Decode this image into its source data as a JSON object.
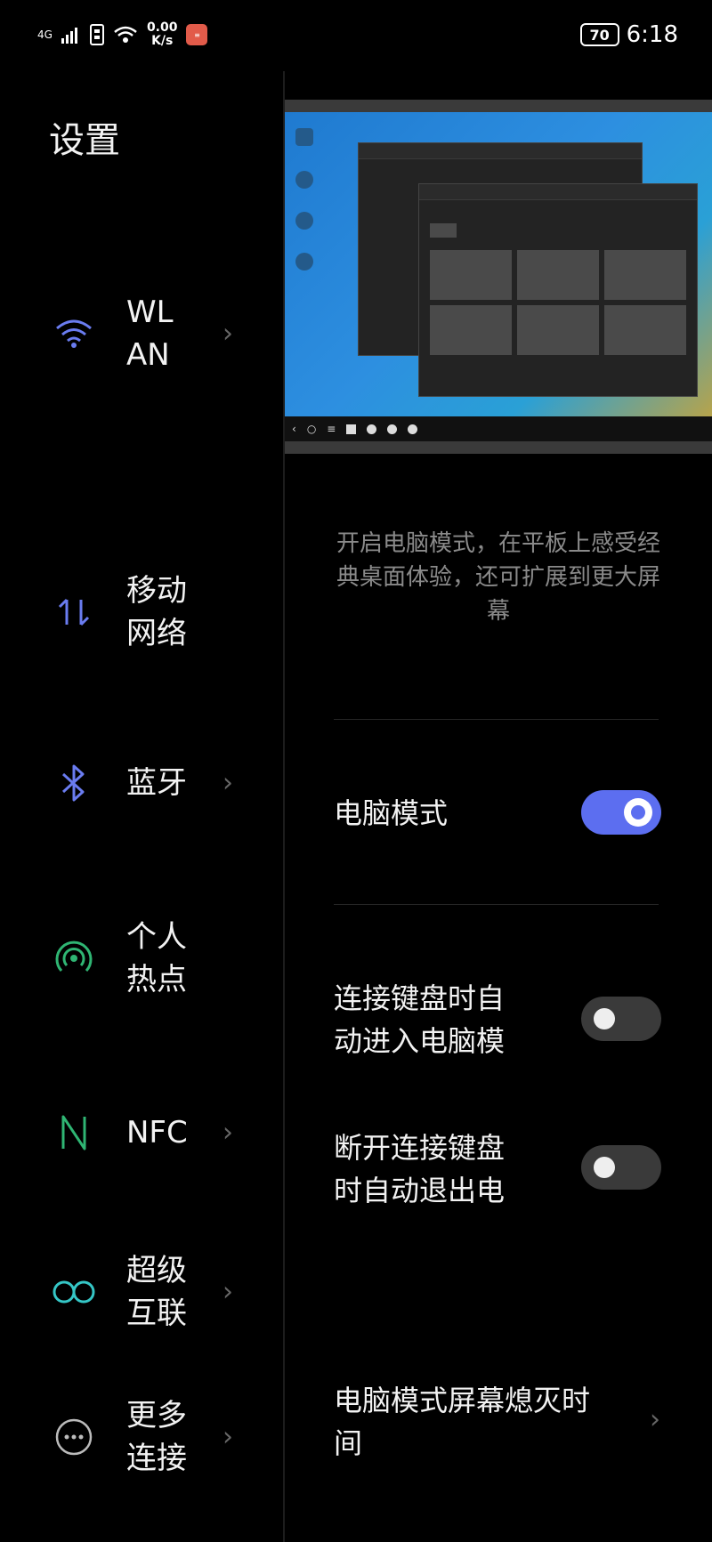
{
  "status_bar": {
    "network": "4G",
    "speed_value": "0.00",
    "speed_unit": "K/s",
    "battery": "70",
    "time": "6:18"
  },
  "sidebar": {
    "title": "设置",
    "items": [
      {
        "label": "WL\nAN",
        "icon": "wifi-icon"
      },
      {
        "label": "移动\n网络",
        "icon": "mobile-data-icon"
      },
      {
        "label": "蓝牙",
        "icon": "bluetooth-icon"
      },
      {
        "label": "个人\n热点",
        "icon": "hotspot-icon"
      },
      {
        "label": "NFC",
        "icon": "nfc-icon"
      },
      {
        "label": "超级\n互联",
        "icon": "super-connect-icon"
      },
      {
        "label": "更多\n连接",
        "icon": "more-connections-icon"
      }
    ]
  },
  "main": {
    "description": "开启电脑模式，在平板上感受经典桌面体验，还可扩展到更大屏幕",
    "pc_mode": {
      "label": "电脑模式",
      "enabled": true
    },
    "auto_enter": {
      "label": "连接键盘时自\n动进入电脑模",
      "enabled": false
    },
    "auto_exit": {
      "label": "断开连接键盘\n时自动退出电",
      "enabled": false
    },
    "screen_off": {
      "label": "电脑模式屏幕熄灭时\n间"
    }
  },
  "colors": {
    "accent": "#5c6ef0",
    "wifi": "#6a7cf0",
    "green": "#2fb573",
    "teal": "#35c6c6"
  }
}
